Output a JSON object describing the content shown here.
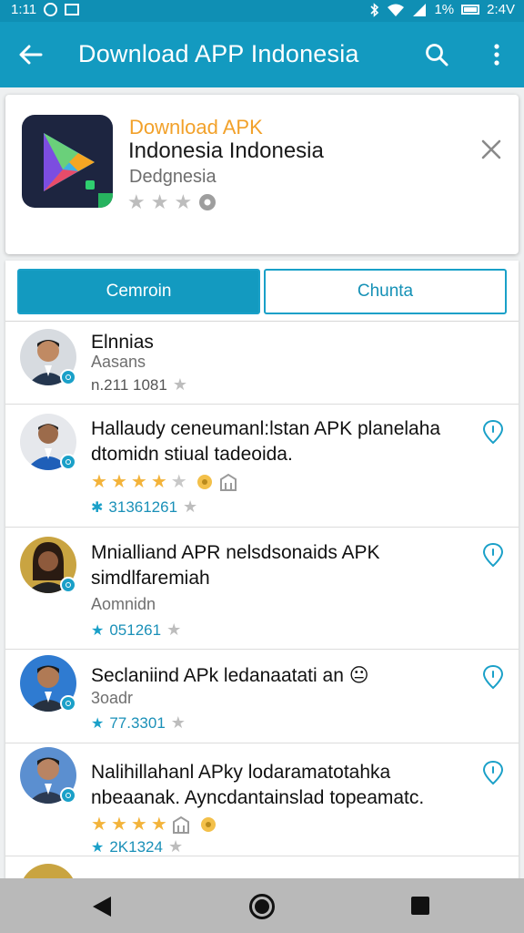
{
  "status_bar": {
    "time_left": "1:11",
    "battery": "1%",
    "time_right": "2:4V"
  },
  "app_bar": {
    "title": "Download APP Indonesia"
  },
  "app_card": {
    "label_top": "Download APK",
    "title": "Indonesia Indonesia",
    "subtitle": "Dedgnesia",
    "rating_stars": 3
  },
  "tabs": [
    {
      "label": "Cemroin",
      "active": true
    },
    {
      "label": "Chunta",
      "active": false
    }
  ],
  "reviews": [
    {
      "text": "Elnnias",
      "sub": "Aasans",
      "meta": "n.211 1081",
      "meta_star": "grey"
    },
    {
      "text": "Hallaudy ceneumanl:lstan APK planelaha dtomidn stiual tadeoida.",
      "stars": [
        1,
        1,
        1,
        1,
        0
      ],
      "meta": "31361261",
      "meta_star": "grey"
    },
    {
      "text": "Mnialliand APR nelsdsonaids APK simdlfaremiah",
      "sub": "Aomnidn",
      "meta": "051261",
      "meta_star": "blue"
    },
    {
      "text": "Seclaniind APk ledanaatati an",
      "emoji": "😐",
      "sub": "3oadr",
      "meta": "77.3301",
      "meta_star": "blue"
    },
    {
      "text": "Nalihillahanl APky lodaramatotahka nbeaanak. Ayncdantainslad topeamatc.",
      "stars": [
        1,
        1,
        1,
        1,
        0
      ],
      "meta": "2K1324",
      "meta_star": "blue"
    }
  ],
  "colors": {
    "primary": "#139ac0",
    "accent": "#f2a12a"
  }
}
